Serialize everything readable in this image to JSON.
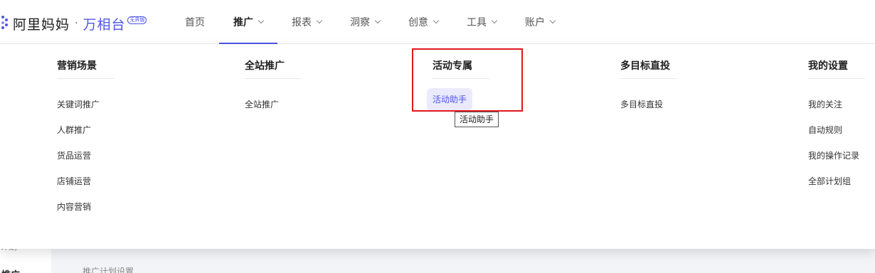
{
  "brand": {
    "name": "阿里妈妈",
    "separator": "·",
    "product": "万相台",
    "badge": "无界版"
  },
  "nav": [
    {
      "label": "首页",
      "has_dropdown": false,
      "active": false
    },
    {
      "label": "推广",
      "has_dropdown": true,
      "active": true
    },
    {
      "label": "报表",
      "has_dropdown": true,
      "active": false
    },
    {
      "label": "洞察",
      "has_dropdown": true,
      "active": false
    },
    {
      "label": "创意",
      "has_dropdown": true,
      "active": false
    },
    {
      "label": "工具",
      "has_dropdown": true,
      "active": false
    },
    {
      "label": "账户",
      "has_dropdown": true,
      "active": false
    }
  ],
  "menu": {
    "columns": [
      {
        "title": "营销场景",
        "items": [
          "关键词推广",
          "人群推广",
          "货品运营",
          "店铺运营",
          "内容营销"
        ]
      },
      {
        "title": "全站推广",
        "items": [
          "全站推广"
        ]
      },
      {
        "title": "活动专属",
        "items": [
          "活动助手"
        ]
      },
      {
        "title": "多目标直投",
        "items": [
          "多目标直投"
        ]
      },
      {
        "title": "我的设置",
        "items": [
          "我的关注",
          "自动规则",
          "我的操作记录",
          "全部计划组"
        ]
      }
    ],
    "highlighted_item": "活动助手",
    "tooltip": "活动助手"
  },
  "background": {
    "left_text": "计划",
    "left_title": "推广",
    "row_hint": "推广计划设置"
  },
  "colors": {
    "accent": "#4c55e6",
    "highlight_bg": "#ebeafd",
    "annotation": "#e1171e"
  }
}
